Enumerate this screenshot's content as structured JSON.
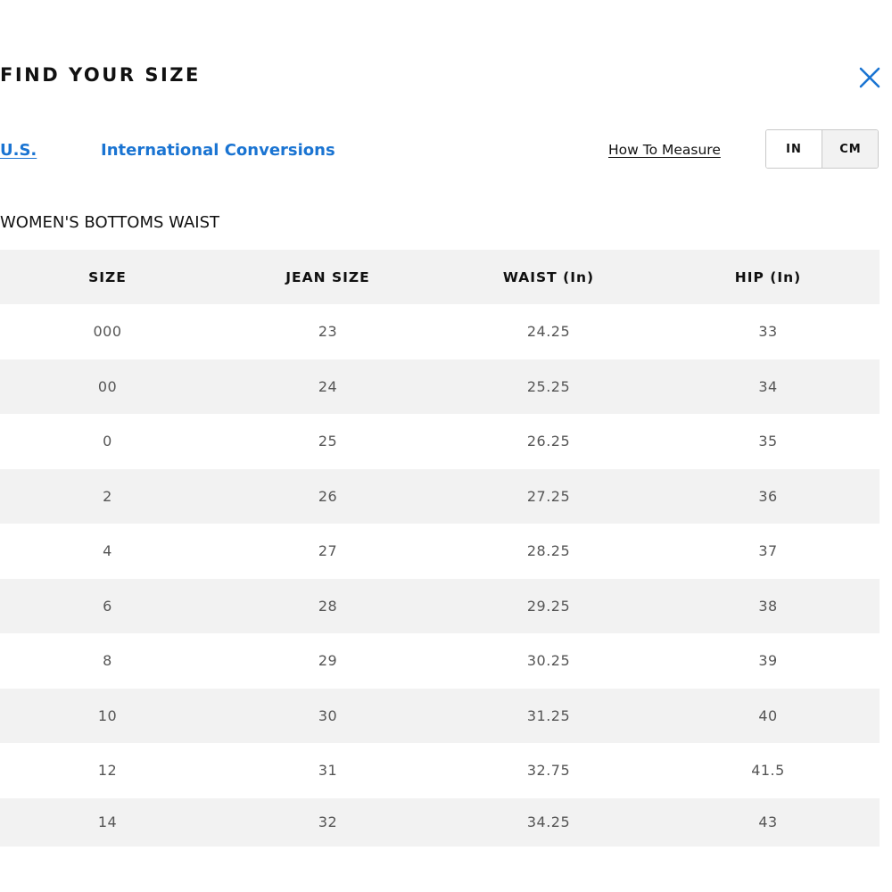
{
  "header": {
    "title": "FIND YOUR SIZE",
    "close_icon": "close-icon",
    "accent_color": "#1a74d2"
  },
  "tabs": [
    {
      "label": "U.S.",
      "active": true
    },
    {
      "label": "International Conversions",
      "active": false
    }
  ],
  "how_to_measure": "How To Measure",
  "units": {
    "options": [
      "IN",
      "CM"
    ],
    "selected": "IN"
  },
  "section_title": "WOMEN'S BOTTOMS WAIST",
  "table": {
    "headers": [
      "SIZE",
      "JEAN SIZE",
      "WAIST (In)",
      "HIP (In)"
    ],
    "rows": [
      [
        "000",
        "23",
        "24.25",
        "33"
      ],
      [
        "00",
        "24",
        "25.25",
        "34"
      ],
      [
        "0",
        "25",
        "26.25",
        "35"
      ],
      [
        "2",
        "26",
        "27.25",
        "36"
      ],
      [
        "4",
        "27",
        "28.25",
        "37"
      ],
      [
        "6",
        "28",
        "29.25",
        "38"
      ],
      [
        "8",
        "29",
        "30.25",
        "39"
      ],
      [
        "10",
        "30",
        "31.25",
        "40"
      ],
      [
        "12",
        "31",
        "32.75",
        "41.5"
      ],
      [
        "14",
        "32",
        "34.25",
        "43"
      ]
    ]
  }
}
